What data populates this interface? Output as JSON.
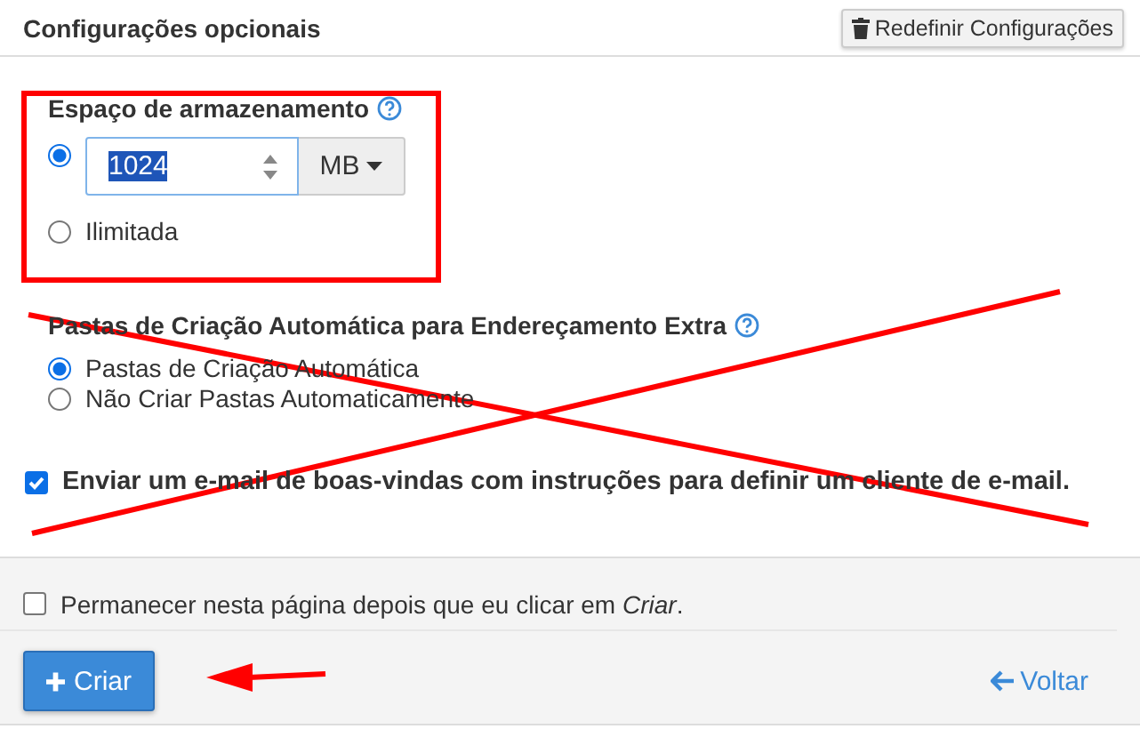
{
  "header": {
    "title": "Configurações opcionais",
    "reset_button": "Redefinir Configurações"
  },
  "storage": {
    "label": "Espaço de armazenamento",
    "options": [
      {
        "kind": "quota",
        "selected": true,
        "value": "1024",
        "value_highlighted": true,
        "unit": "MB"
      },
      {
        "kind": "unlimited",
        "selected": false,
        "label": "Ilimitada"
      }
    ]
  },
  "folders": {
    "label": "Pastas de Criação Automática para Endereçamento Extra",
    "options": [
      {
        "label": "Pastas de Criação Automática",
        "selected": true
      },
      {
        "label": "Não Criar Pastas Automaticamente",
        "selected": false
      }
    ]
  },
  "welcome_email": {
    "label": "Enviar um e-mail de boas-vindas com instruções para definir um cliente de e-mail.",
    "checked": true
  },
  "footer": {
    "stay_on_page": {
      "label": "Permanecer nesta página depois que eu clicar em *Criar*.",
      "checked": false
    },
    "create_button": "Criar",
    "back_link": "Voltar"
  }
}
